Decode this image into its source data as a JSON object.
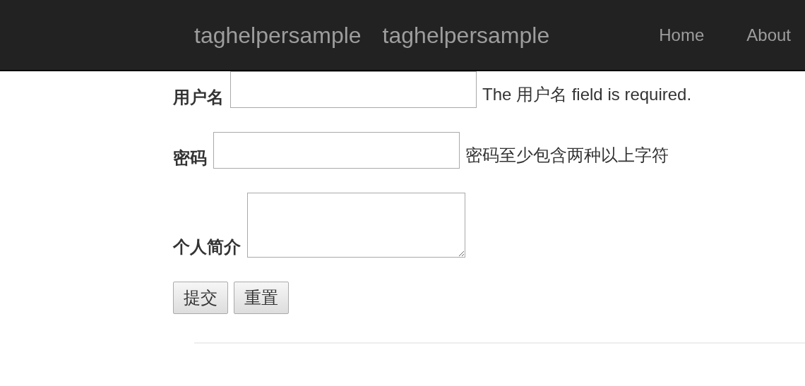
{
  "navbar": {
    "brands": [
      "taghelpersample",
      "taghelpersample"
    ],
    "links": [
      {
        "label": "Home"
      },
      {
        "label": "About"
      }
    ]
  },
  "form": {
    "fields": [
      {
        "label": "用户名",
        "kind": "text",
        "message": "The 用户名 field is required."
      },
      {
        "label": "密码",
        "kind": "password",
        "message": "密码至少包含两种以上字符"
      },
      {
        "label": "个人简介",
        "kind": "textarea"
      }
    ],
    "buttons": [
      "提交",
      "重置"
    ]
  }
}
